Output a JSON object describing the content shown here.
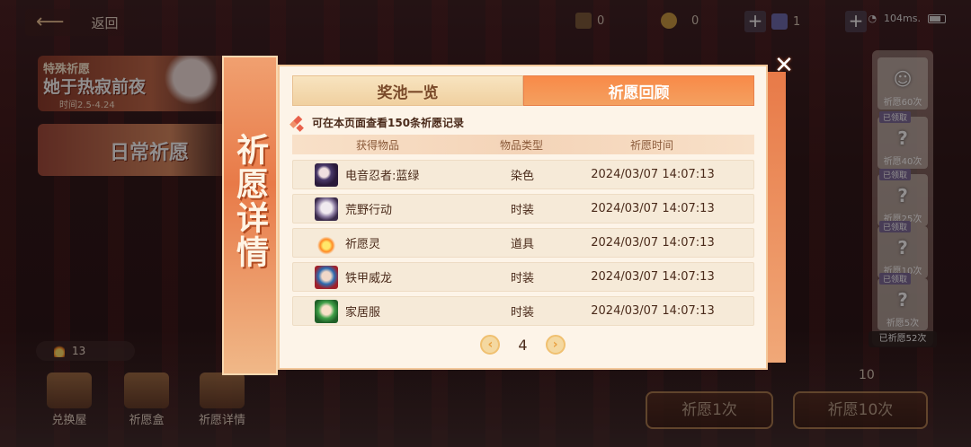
{
  "top": {
    "back_label": "返回",
    "res1": "0",
    "res2": "0",
    "res3": "1",
    "ping": "104ms."
  },
  "banners": {
    "special_tag": "特殊祈愿",
    "special_title": "她于热寂前夜",
    "special_date": "时间2.5-4.24",
    "daily_title": "日常祈愿"
  },
  "coins": "13",
  "bottom_nav": [
    {
      "label": "兑换屋"
    },
    {
      "label": "祈愿盒"
    },
    {
      "label": "祈愿详情"
    }
  ],
  "rewards": {
    "items": [
      {
        "count": "祈愿60次",
        "got": "已领取"
      },
      {
        "count": "祈愿40次",
        "got": "已领取"
      },
      {
        "count": "祈愿25次",
        "got": "已领取"
      },
      {
        "count": "祈愿10次",
        "got": "已领取"
      },
      {
        "count": "祈愿5次",
        "got": ""
      }
    ],
    "total": "已祈愿52次",
    "ten_count": "10"
  },
  "wish_buttons": {
    "once": "祈愿1次",
    "ten": "祈愿10次"
  },
  "modal": {
    "side_title": "祈愿详情",
    "tab_pool": "奖池一览",
    "tab_history": "祈愿回顾",
    "hint": "可在本页面查看150条祈愿记录",
    "col_item": "获得物品",
    "col_type": "物品类型",
    "col_time": "祈愿时间",
    "rows": [
      {
        "name": "电音忍者:蓝绿",
        "type": "染色",
        "time": "2024/03/07 14:07:13",
        "icon": "ii-purple"
      },
      {
        "name": "荒野行动",
        "type": "时装",
        "time": "2024/03/07 14:07:13",
        "icon": "ii-gray"
      },
      {
        "name": "祈愿灵",
        "type": "道具",
        "time": "2024/03/07 14:07:13",
        "icon": "ii-flame"
      },
      {
        "name": "铁甲威龙",
        "type": "时装",
        "time": "2024/03/07 14:07:13",
        "icon": "ii-blue"
      },
      {
        "name": "家居服",
        "type": "时装",
        "time": "2024/03/07 14:07:13",
        "icon": "ii-green"
      }
    ],
    "page": "4"
  }
}
